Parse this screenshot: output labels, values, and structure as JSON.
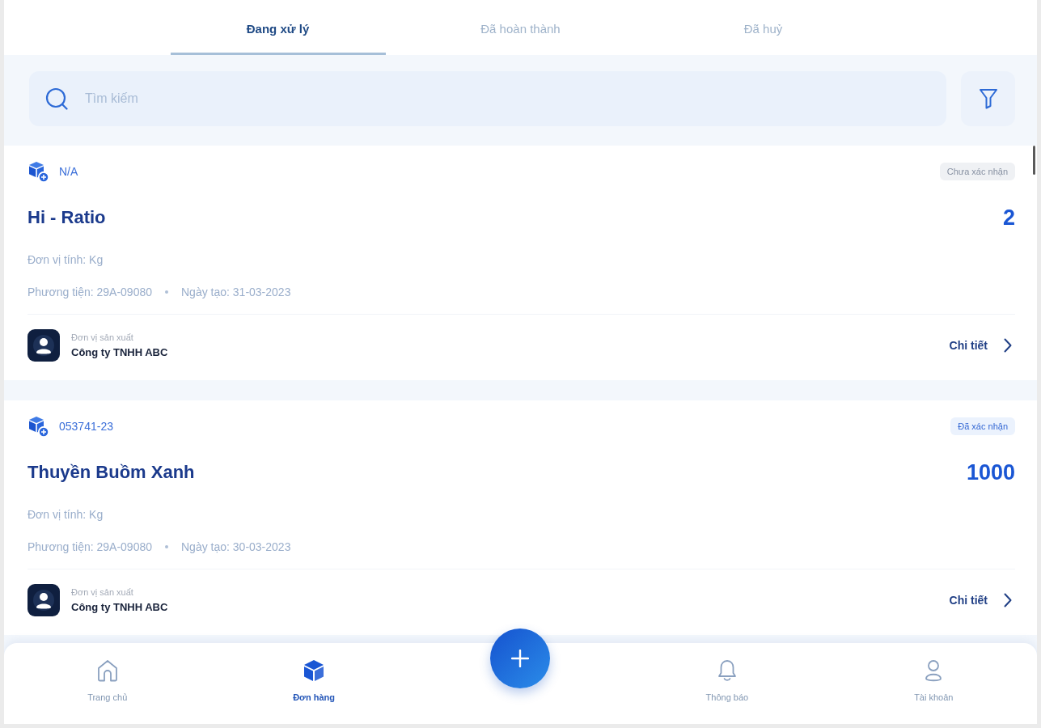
{
  "tabs": [
    {
      "label": "Đang xử lý",
      "selected": true
    },
    {
      "label": "Đã hoàn thành",
      "selected": false
    },
    {
      "label": "Đã huỷ",
      "selected": false
    }
  ],
  "search": {
    "placeholder": "Tìm kiếm"
  },
  "orders": [
    {
      "code": "N/A",
      "status": {
        "label": "Chưa xác nhận",
        "confirmed": false
      },
      "name": "Hi - Ratio",
      "quantity": "2",
      "unit": "Đơn vị tính: Kg",
      "vehicle": "Phương tiện: 29A-09080",
      "created": "Ngày tạo: 31-03-2023",
      "producer_label": "Đơn vị sản xuất",
      "producer": "Công ty TNHH ABC",
      "detail_link": "Chi tiết"
    },
    {
      "code": "053741-23",
      "status": {
        "label": "Đã xác nhận",
        "confirmed": true
      },
      "name": "Thuyền Buồm Xanh",
      "quantity": "1000",
      "unit": "Đơn vị tính: Kg",
      "vehicle": "Phương tiện: 29A-09080",
      "created": "Ngày tạo: 30-03-2023",
      "producer_label": "Đơn vị sản xuất",
      "producer": "Công ty TNHH ABC",
      "detail_link": "Chi tiết"
    }
  ],
  "bottom_nav": [
    {
      "kind": "tab",
      "label": "Trang chủ",
      "selected": false
    },
    {
      "kind": "tab",
      "label": "Đơn hàng",
      "selected": true
    },
    {
      "kind": "fab"
    },
    {
      "kind": "tab",
      "label": "Thông báo",
      "selected": false
    },
    {
      "kind": "tab",
      "label": "Tài khoản",
      "selected": false
    }
  ]
}
